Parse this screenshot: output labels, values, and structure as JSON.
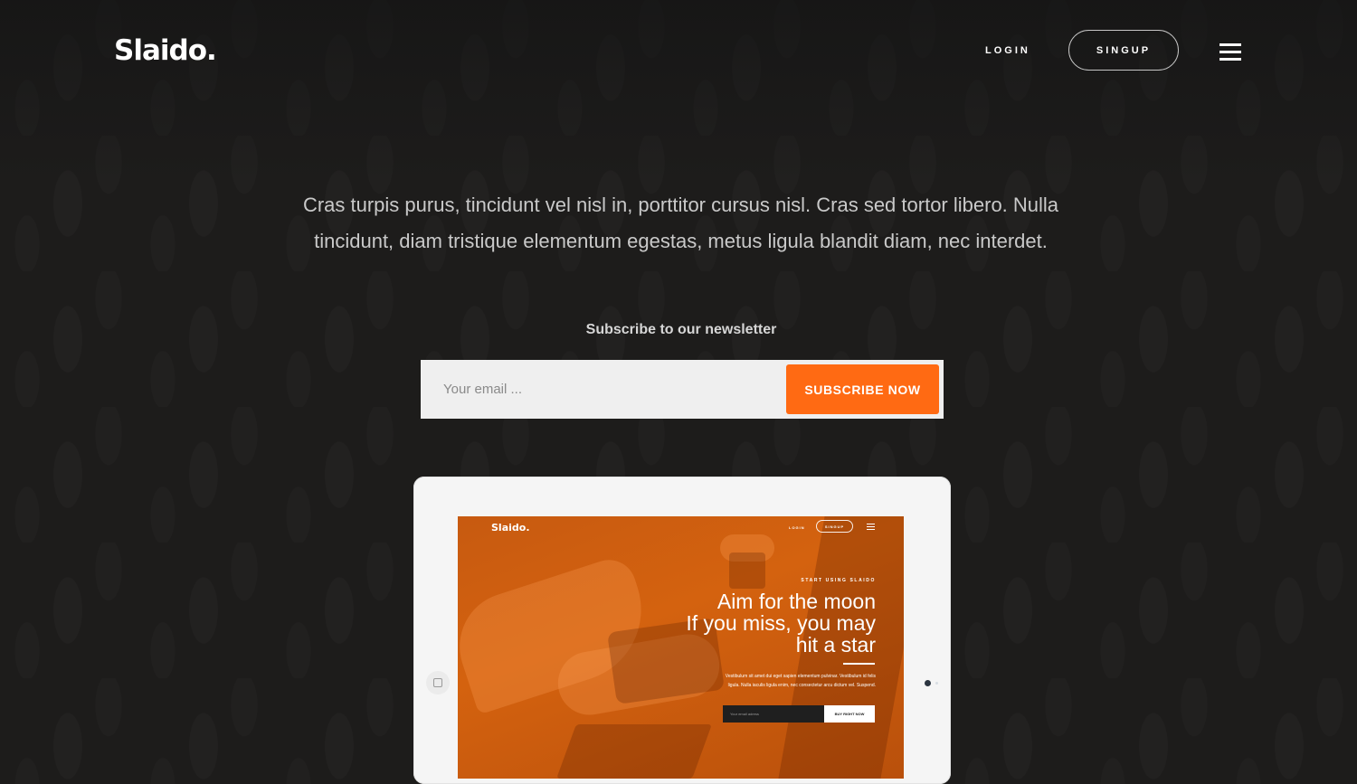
{
  "header": {
    "logo": "Slaido.",
    "login_label": "LOGIN",
    "signup_label": "SINGUP",
    "menu_icon": "hamburger-icon"
  },
  "hero": {
    "text": "Cras turpis purus, tincidunt vel nisl in, porttitor cursus nisl. Cras sed tortor libero. Nulla tincidunt, diam tristique elementum egestas, metus ligula blandit diam, nec interdet."
  },
  "newsletter": {
    "label": "Subscribe to our newsletter",
    "email_placeholder": "Your email ...",
    "button_label": "SUBSCRIBE NOW"
  },
  "preview": {
    "logo": "Slaido.",
    "login_label": "LOGIN",
    "signup_label": "SINGUP",
    "kicker": "START USING SLAIDO",
    "headline_1": "Aim for the moon",
    "headline_2": "If you miss, you may",
    "headline_3": "hit a star",
    "body": "Vestibulum sit amet dui eget sapien elementum pulvinar. Vestibulum id felis ligula. Nulla iaculis ligula enim, nec consectetur arcu dictum vel. Suspend.",
    "email_placeholder": "Your email adress",
    "button_label": "BUY RIGHT NOW"
  },
  "colors": {
    "background": "#1d1c1b",
    "accent": "#ff6a13",
    "screen": "#d4620f"
  }
}
